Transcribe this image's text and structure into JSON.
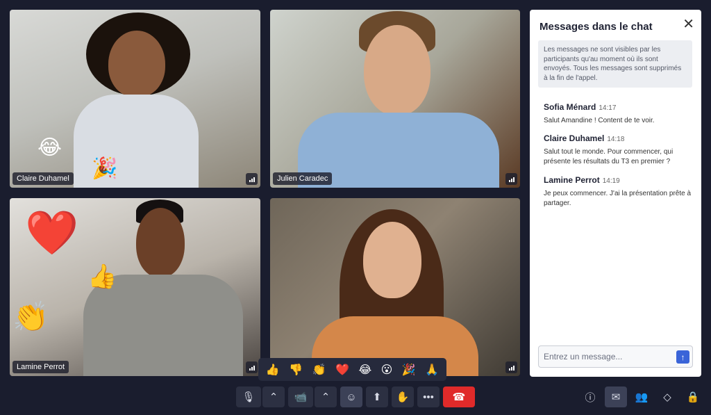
{
  "participants": [
    {
      "name": "Claire Duhamel"
    },
    {
      "name": "Julien Caradec"
    },
    {
      "name": "Lamine Perrot"
    },
    {
      "name": ""
    }
  ],
  "chat": {
    "title": "Messages dans le chat",
    "notice": "Les messages ne sont visibles par les participants qu'au moment où ils sont envoyés. Tous les messages sont supprimés à la fin de l'appel.",
    "messages": [
      {
        "author": "Sofia Ménard",
        "time": "14:17",
        "text": "Salut Amandine ! Content de te voir."
      },
      {
        "author": "Claire Duhamel",
        "time": "14:18",
        "text": "Salut tout le monde. Pour commencer, qui présente les résultats du T3 en premier ?"
      },
      {
        "author": "Lamine Perrot",
        "time": "14:19",
        "text": "Je peux commencer. J'ai la présentation prête à partager."
      }
    ],
    "input_placeholder": "Entrez un message..."
  },
  "reactions": [
    "👍",
    "👎",
    "👏",
    "❤️",
    "😂",
    "😮",
    "🎉",
    "🙏"
  ],
  "floating_emojis": {
    "tile1_laugh": "😂",
    "tile1_party": "🎉",
    "tile3_heart": "❤️",
    "tile3_thumbs": "👍",
    "tile3_clap": "👏"
  },
  "toolbar": {
    "mic_icon": "🎙",
    "mic_more": "⌃",
    "camera_icon": "📹",
    "camera_more": "⌃",
    "reaction_icon": "☺",
    "share_icon": "⬆",
    "hand_icon": "✋",
    "more_icon": "•••",
    "hangup_icon": "☎",
    "info_icon": "ⓘ",
    "chat_icon": "✉",
    "people_icon": "👥",
    "apps_icon": "◇",
    "lock_icon": "🔒"
  },
  "colors": {
    "background": "#1a1d2e",
    "accent": "#3a64d8",
    "hangup": "#e02a2a"
  }
}
